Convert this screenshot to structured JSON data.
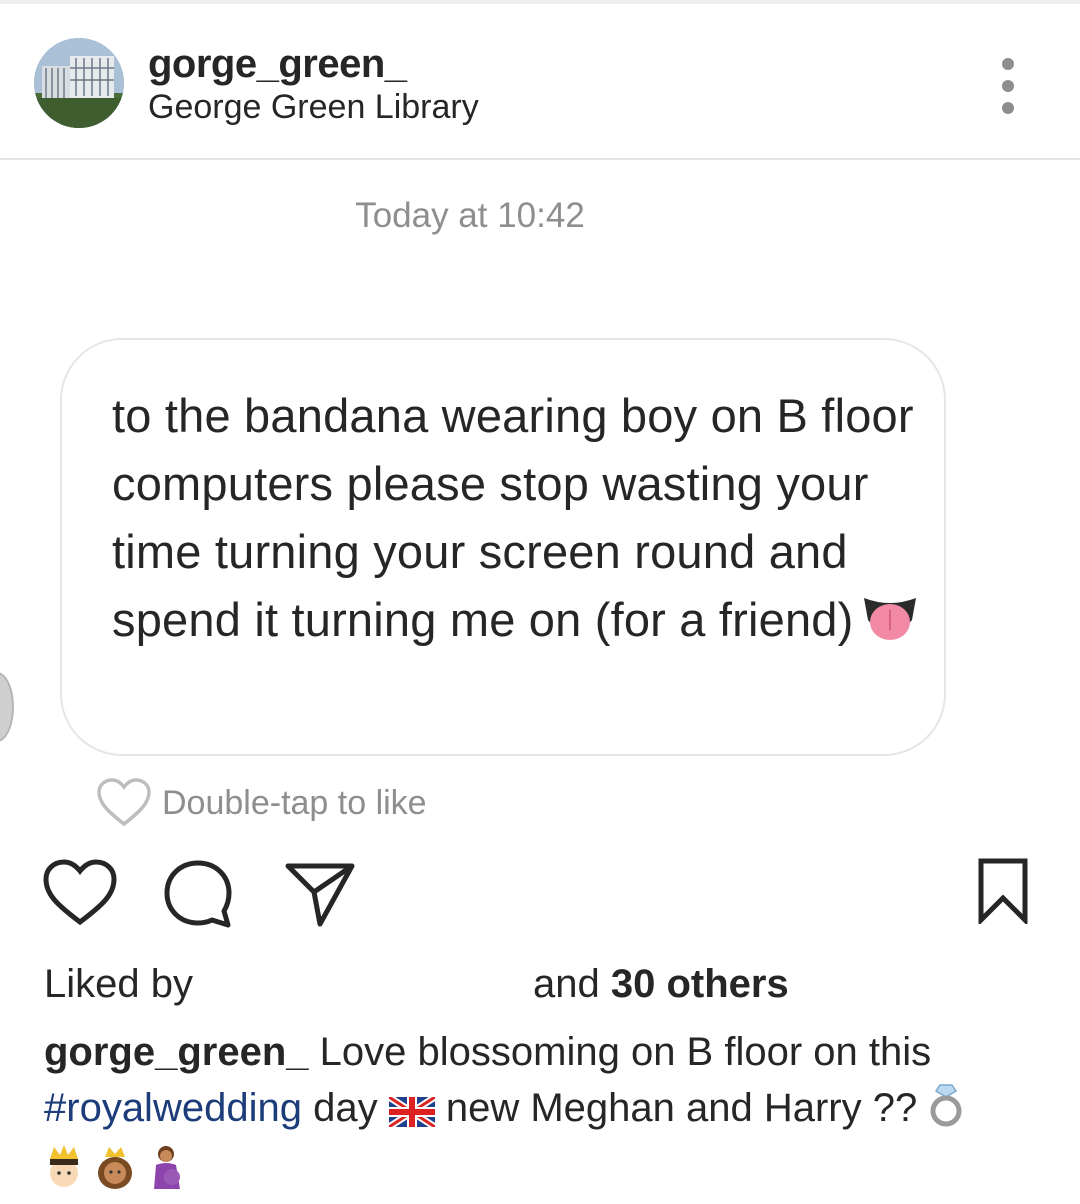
{
  "post": {
    "username": "gorge_green_",
    "location": "George Green Library"
  },
  "message": {
    "timestamp": "Today at 10:42",
    "text": "to the bandana wearing boy on B floor computers please stop wasting your time turning your screen round and spend it turning me on (for a friend)",
    "double_tap_hint": "Double-tap to like"
  },
  "likes": {
    "prefix": "Liked by",
    "suffix": "and",
    "others": "30 others"
  },
  "caption": {
    "username": "gorge_green_",
    "text_1": "Love blossoming on B floor on this",
    "hashtag": "#royalwedding",
    "text_2": "day",
    "text_3": "new Meghan and Harry ??"
  },
  "icons": [
    "more-icon",
    "heart-icon",
    "comment-icon",
    "share-icon",
    "bookmark-icon"
  ]
}
